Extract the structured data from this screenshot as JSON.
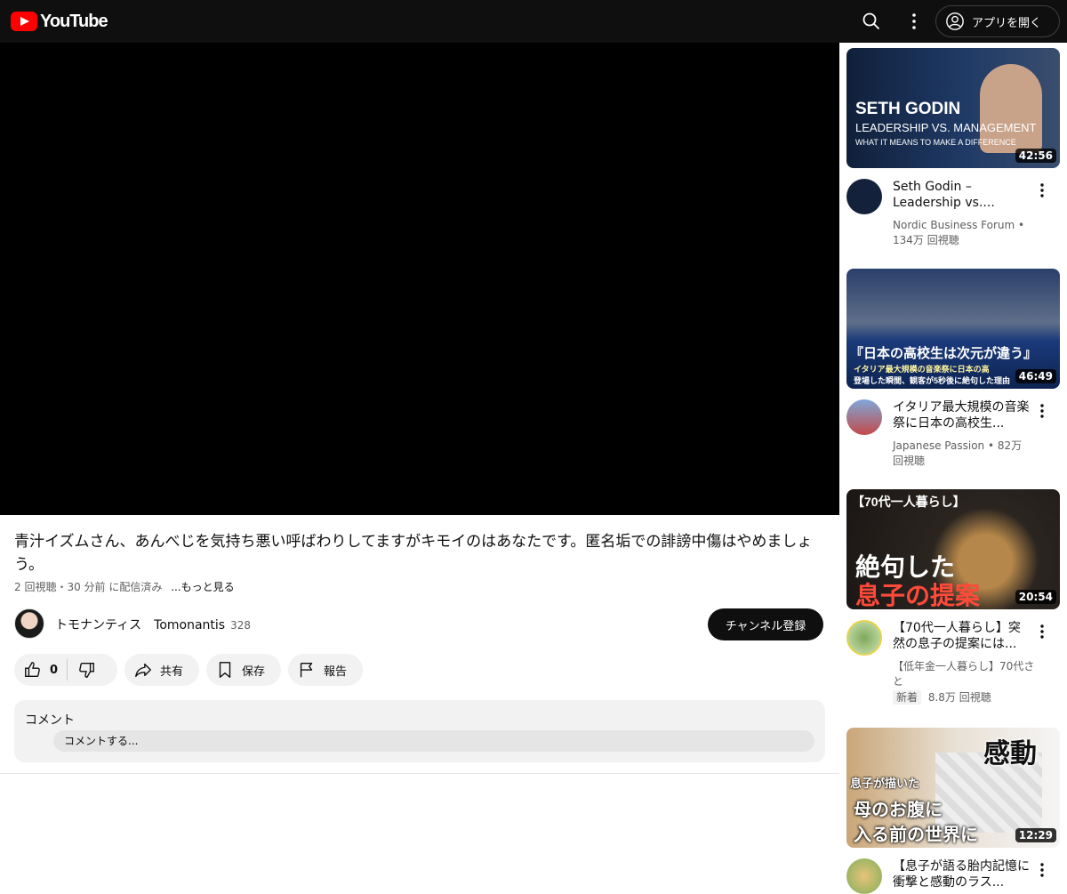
{
  "header": {
    "logo_text": "YouTube",
    "open_app_label": "アプリを開く"
  },
  "video": {
    "title": "青汁イズムさん、あんべじを気持ち悪い呼ばわりしてますがキモイのはあなたです。匿名垢での誹謗中傷はやめましょう。",
    "meta": "2 回視聴・30 分前 に配信済み",
    "more_label": "...もっと見る",
    "channel_name": "トモナンティス　Tomonantis",
    "subscriber_count": "328",
    "subscribe_label": "チャンネル登録",
    "like_count": "0",
    "share_label": "共有",
    "save_label": "保存",
    "report_label": "報告"
  },
  "comments": {
    "title": "コメント",
    "placeholder": "コメントする..."
  },
  "recommendations": [
    {
      "thumb_lines": [
        "SETH GODIN",
        "LEADERSHIP VS. MANAGEMENT",
        "WHAT IT MEANS TO MAKE A DIFFERENCE"
      ],
      "duration": "42:56",
      "title": "Seth Godin – Leadership vs....",
      "channel": "Nordic Business Forum",
      "views": "134万 回視聴"
    },
    {
      "thumb_lines": [
        "『日本の高校生は次元が違う』",
        "イタリア最大規模の音楽祭に日本の高",
        "登場した瞬間、観客が5秒後に絶句した理由"
      ],
      "duration": "46:49",
      "title": "イタリア最大規模の音楽祭に日本の高校生...",
      "channel": "Japanese Passion",
      "views": "82万 回視聴"
    },
    {
      "thumb_lines": [
        "【70代一人暮らし】",
        "絶句した",
        "息子の提案"
      ],
      "duration": "20:54",
      "title": "【70代一人暮らし】突然の息子の提案には...",
      "channel": "【低年金一人暮らし】70代さと",
      "badge": "新着",
      "views": "8.8万 回視聴"
    },
    {
      "thumb_lines": [
        "感動",
        "息子が描いた",
        "母のお腹に",
        "入る前の世界に"
      ],
      "duration": "12:29",
      "title": "【息子が語る胎内記憶に衝撃と感動のラス..."
    }
  ]
}
